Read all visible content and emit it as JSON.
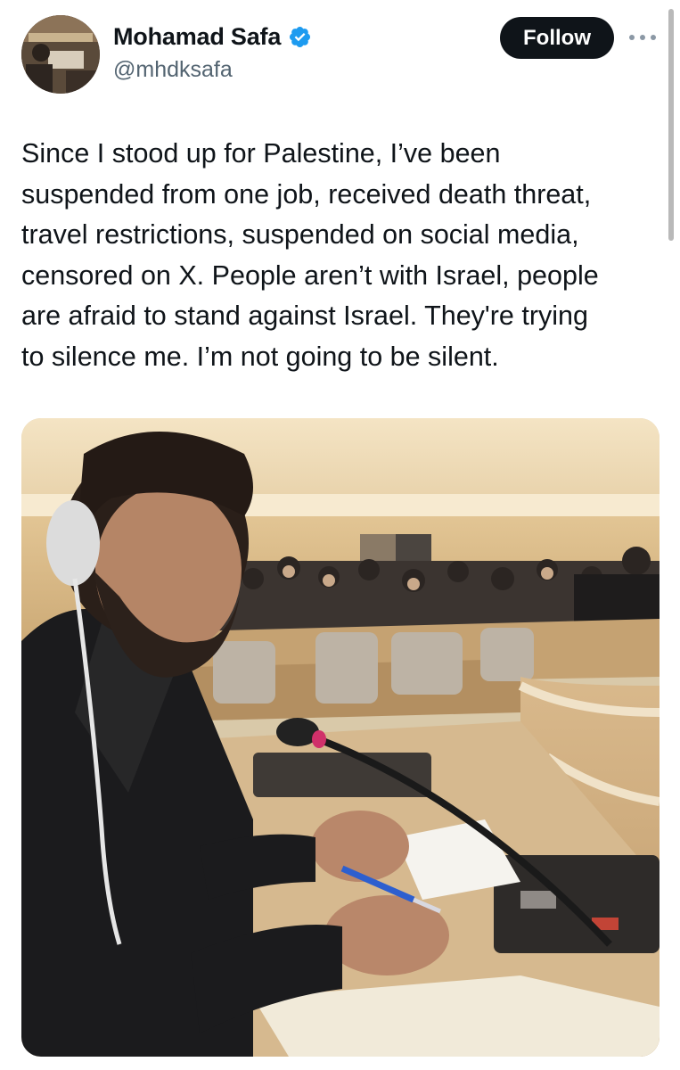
{
  "author": {
    "name": "Mohamad Safa",
    "handle": "@mhdksafa",
    "verified": true,
    "verified_color": "#1d9bf0"
  },
  "actions": {
    "follow_label": "Follow"
  },
  "post": {
    "text": "Since I stood up for Palestine, I’ve been\nsuspended from one job, received death threat,\ntravel restrictions, suspended on social media,\ncensored on X. People aren’t with Israel, people\nare afraid to stand against Israel. They're trying\nto silence me. I’m not going to be silent."
  },
  "icons": {
    "verified": "verified-badge-icon",
    "more": "more-options-icon"
  },
  "colors": {
    "text": "#0f1419",
    "secondary_text": "#536471",
    "follow_button_bg": "#0f1419"
  }
}
